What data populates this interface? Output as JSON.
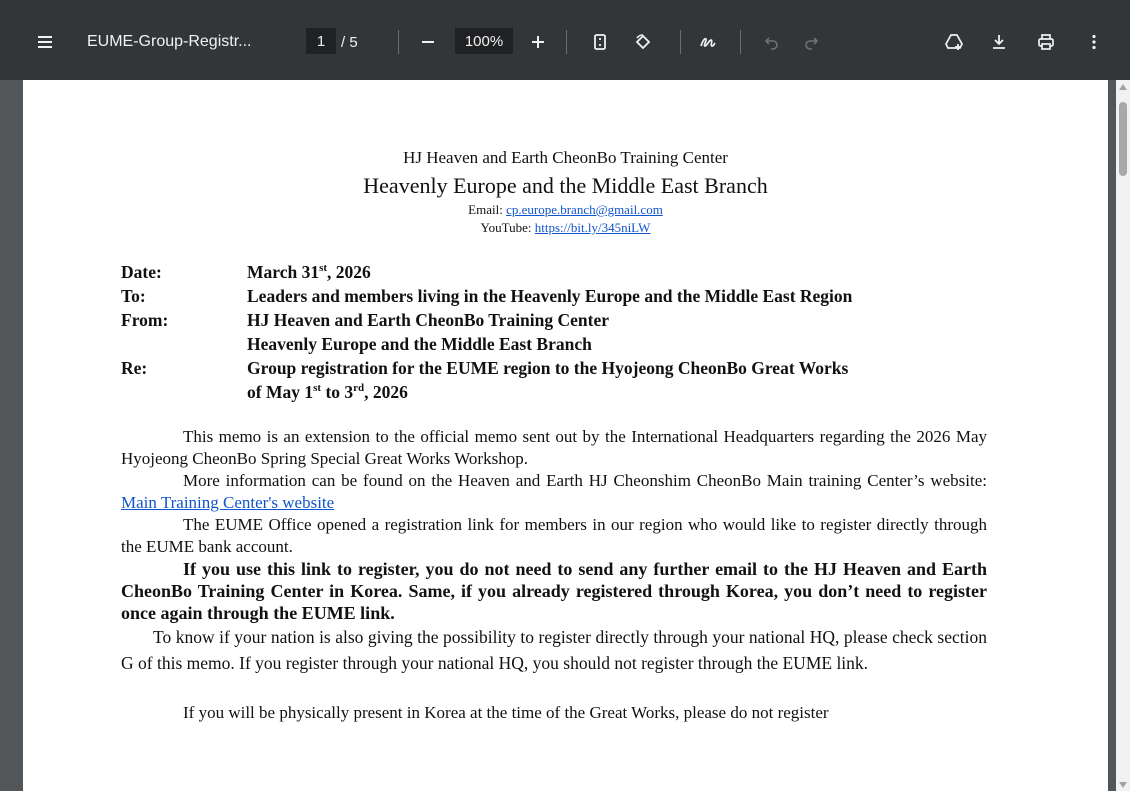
{
  "toolbar": {
    "title": "EUME-Group-Registr...",
    "page_current": "1",
    "page_total": "/ 5",
    "zoom": "100%"
  },
  "header": {
    "line1": "HJ Heaven and Earth CheonBo Training Center",
    "line2": "Heavenly Europe and the Middle East Branch",
    "email_label": "Email: ",
    "email": "cp.europe.branch@gmail.com",
    "youtube_label": "YouTube: ",
    "youtube": "https://bit.ly/345niLW"
  },
  "memo": {
    "date_label": "Date:",
    "date_pre": "March 31",
    "date_sup": "st",
    "date_post": ", 2026",
    "to_label": "To:",
    "to": "Leaders and members living in the Heavenly Europe and the Middle East Region",
    "from_label": "From:",
    "from1": "HJ Heaven and Earth CheonBo Training Center",
    "from2": "Heavenly Europe and the Middle East Branch",
    "re_label": "Re:",
    "re1": "Group registration for the EUME region to the Hyojeong CheonBo Great Works",
    "re2_pre": "of May 1",
    "re2_sup1": "st",
    "re2_mid": " to 3",
    "re2_sup2": "rd",
    "re2_post": ",  2026"
  },
  "body": {
    "p1": "This memo is an extension to the official memo sent out by the International Headquarters regarding the 2026 May Hyojeong CheonBo Spring Special Great Works Workshop.",
    "p2_pre": "More information can be found on the Heaven and Earth HJ Cheonshim CheonBo Main training Center’s website: ",
    "p2_link": "Main Training Center's website",
    "p3": "The EUME Office opened a registration link for members in our region who would like to register directly through the EUME bank account.",
    "p4": "If you use this link to register, you do not need to send any further email to the HJ Heaven and Earth CheonBo Training Center in Korea. Same, if you already registered through Korea, you don’t need to register once again through the EUME link.",
    "p5": "To know if your nation is also giving the possibility to register directly through your national HQ, please check section G of this memo. If you register through your national HQ, you should not register through the EUME link.",
    "p6_partial": "If you will be physically present in Korea at the time of the Great Works, please do not register"
  }
}
